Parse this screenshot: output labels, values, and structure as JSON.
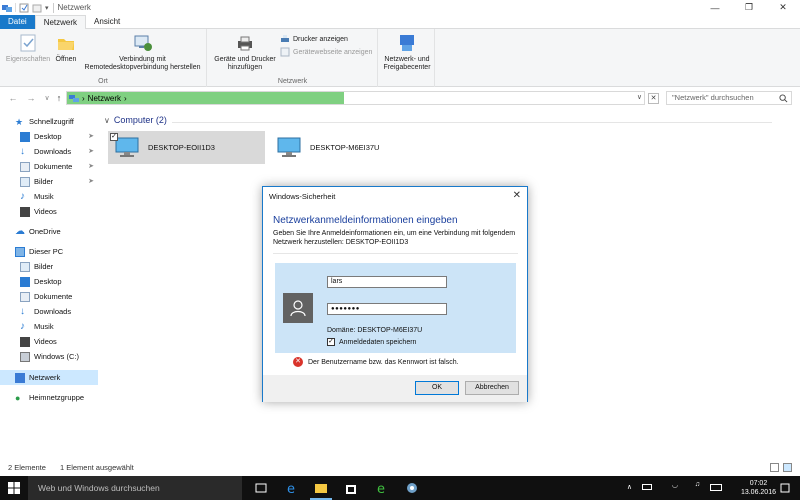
{
  "window": {
    "title": "Netzwerk",
    "controls": [
      "minimize",
      "maximize",
      "close"
    ]
  },
  "ribbon_tabs": [
    {
      "label": "Datei"
    },
    {
      "label": "Netzwerk"
    },
    {
      "label": "Ansicht"
    }
  ],
  "ribbon": {
    "ort": {
      "group_label": "Ort",
      "eigenschaften": "Eigenschaften",
      "oeffnen": "Öffnen",
      "remote_line1": "Verbindung mit",
      "remote_line2": "Remotedesktopverbindung herstellen"
    },
    "netzwerk": {
      "group_label": "Netzwerk",
      "geraete_line1": "Geräte und Drucker",
      "geraete_line2": "hinzufügen",
      "drucker": "Drucker anzeigen",
      "webseite": "Gerätewebseite anzeigen"
    },
    "center": {
      "line1": "Netzwerk- und",
      "line2": "Freigabecenter"
    }
  },
  "address_bar": {
    "path": "Netzwerk",
    "chevron": "›",
    "progress_fraction": 0.48
  },
  "search": {
    "placeholder": "\"Netzwerk\" durchsuchen"
  },
  "nav_pane": {
    "quick_access": "Schnellzugriff",
    "quick_items": [
      {
        "label": "Desktop",
        "pinned": true
      },
      {
        "label": "Downloads",
        "pinned": true
      },
      {
        "label": "Dokumente",
        "pinned": true
      },
      {
        "label": "Bilder",
        "pinned": true
      },
      {
        "label": "Musik",
        "pinned": false
      },
      {
        "label": "Videos",
        "pinned": false
      }
    ],
    "onedrive": "OneDrive",
    "this_pc": "Dieser PC",
    "pc_items": [
      {
        "label": "Bilder"
      },
      {
        "label": "Desktop"
      },
      {
        "label": "Dokumente"
      },
      {
        "label": "Downloads"
      },
      {
        "label": "Musik"
      },
      {
        "label": "Videos"
      },
      {
        "label": "Windows (C:)"
      }
    ],
    "network": "Netzwerk",
    "homegroup": "Heimnetzgruppe"
  },
  "content": {
    "group_header": "Computer (2)",
    "computers": [
      {
        "name": "DESKTOP-EOII1D3",
        "selected": true
      },
      {
        "name": "DESKTOP-M6EI37U",
        "selected": false
      }
    ]
  },
  "status_bar": {
    "count": "2 Elemente",
    "selected": "1 Element ausgewählt"
  },
  "dialog": {
    "title": "Windows-Sicherheit",
    "close": "✕",
    "heading": "Netzwerkanmeldeinformationen eingeben",
    "description": "Geben Sie Ihre Anmeldeinformationen ein, um eine Verbindung mit folgendem Netzwerk herzustellen: DESKTOP-EOII1D3",
    "username": "lars",
    "password_mask": "●●●●●●●",
    "domain": "Domäne: DESKTOP-M6EI37U",
    "remember_label": "Anmeldedaten speichern",
    "remember_checked": true,
    "error": "Der Benutzername bzw. das Kennwort ist falsch.",
    "ok": "OK",
    "cancel": "Abbrechen"
  },
  "taskbar": {
    "search_placeholder": "Web und Windows durchsuchen",
    "time": "07:02",
    "date": "13.06.2016"
  },
  "colors": {
    "accent": "#1979ca",
    "address_progress": "#7fd081",
    "selection": "#cce8ff",
    "credential_panel": "#cce4f7",
    "dialog_heading": "#1a3f9d",
    "error": "#d9342b",
    "taskbar": "#101010"
  }
}
